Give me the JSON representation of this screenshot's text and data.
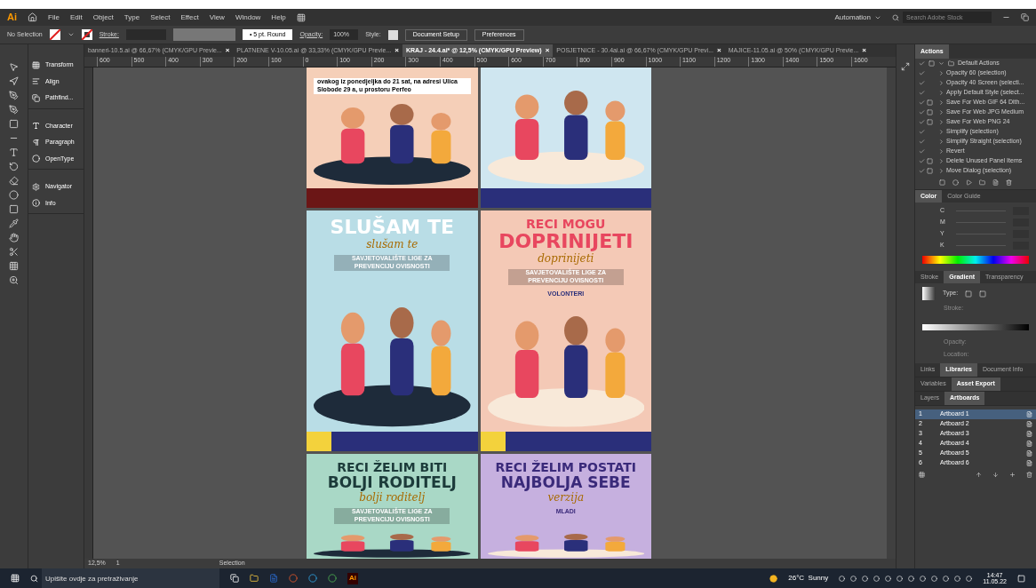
{
  "menu_bar": {
    "app_logo": "Ai",
    "items": [
      "File",
      "Edit",
      "Object",
      "Type",
      "Select",
      "Effect",
      "View",
      "Window",
      "Help"
    ],
    "workspace": "Automation",
    "search": {
      "placeholder": "Search Adobe Stock"
    }
  },
  "control_bar": {
    "selection": "No Selection",
    "stroke_label": "Stroke:",
    "brush": "• 5 pt. Round",
    "opacity_label": "Opacity:",
    "opacity": "100%",
    "style_label": "Style:",
    "buttons": [
      "Document Setup",
      "Preferences"
    ]
  },
  "document_tabs": [
    {
      "label": "banneri-10.5.ai @ 66,67% (CMYK/GPU Previe...",
      "close": "×",
      "selected": false
    },
    {
      "label": "PLATNENE V-10.05.ai @ 33,33% (CMYK/GPU Previe...",
      "close": "×",
      "selected": false
    },
    {
      "label": "KRAJ - 24.4.ai* @ 12,5% (CMYK/GPU Preview)",
      "close": "×",
      "selected": true
    },
    {
      "label": "POSJETNICE - 30.4ai.ai @ 66,67% (CMYK/GPU Previ...",
      "close": "×",
      "selected": false
    },
    {
      "label": "MAJICE-11.05.ai @ 50% (CMYK/GPU Previe...",
      "close": "×",
      "selected": false
    }
  ],
  "ruler_labels": [
    "600",
    "500",
    "400",
    "300",
    "200",
    "100",
    "0",
    "100",
    "200",
    "300",
    "400",
    "500",
    "600",
    "700",
    "800",
    "900",
    "1000",
    "1100",
    "1200",
    "1300",
    "1400",
    "1500",
    "1600"
  ],
  "left_panels": [
    [
      "Transform",
      "Align",
      "Pathfind..."
    ],
    [
      "Character",
      "Paragraph",
      "OpenType"
    ],
    [
      "Navigator",
      "Info"
    ]
  ],
  "posters": [
    {
      "note": "ovakog  iz ponedjeljka do 21 sat, na adresi Ulica Slobode 29 a, u prostoru Perfeo",
      "footer": true
    },
    {
      "footer": true
    },
    {
      "footer": true,
      "headline": [
        "SLUŠAM TE"
      ],
      "script": "slušam te",
      "subtitle": "SAVJETOVALIŠTE LIGE ZA PREVENCIJU OVISNOSTI"
    },
    {
      "footer": true,
      "headline": [
        "RECI MOGU",
        "DOPRINIJETI"
      ],
      "script": "doprinijeti",
      "subtitle": "SAVJETOVALIŠTE LIGE ZA PREVENCIJU OVISNOSTI",
      "note": "VOLONTERI"
    },
    {
      "headline": [
        "RECI ŽELIM BITI",
        "BOLJI RODITELJ"
      ],
      "script": "bolji roditelj",
      "subtitle": "SAVJETOVALIŠTE LIGE ZA PREVENCIJU OVISNOSTI"
    },
    {
      "headline": [
        "RECI ŽELIM POSTATI",
        "NAJBOLJA SEBE"
      ],
      "script": "verzija",
      "note": "MLADI"
    }
  ],
  "status_bar": {
    "zoom": "12,5%",
    "artboard": "1",
    "tool": "Selection"
  },
  "actions_panel": {
    "tab": "Actions",
    "set": {
      "label": "Default Actions",
      "expanded": true,
      "children": [
        {
          "label": "Opacity 60 (selection)",
          "dialog": false
        },
        {
          "label": "Opacity 40 Screen (selecti...",
          "dialog": false
        },
        {
          "label": "Apply Default Style (select...",
          "dialog": false
        },
        {
          "label": "Save For Web GIF 64 Dith...",
          "dialog": true
        },
        {
          "label": "Save For Web JPG Medium",
          "dialog": true
        },
        {
          "label": "Save For Web PNG 24",
          "dialog": true
        },
        {
          "label": "Simplify (selection)",
          "dialog": false
        },
        {
          "label": "Simplify Straight (selection)",
          "dialog": false
        },
        {
          "label": "Revert",
          "dialog": false
        },
        {
          "label": "Delete Unused Panel Items",
          "dialog": true
        },
        {
          "label": "Move Dialog (selection)",
          "dialog": true
        }
      ]
    }
  },
  "color_panel": {
    "tabs": [
      {
        "label": "Color",
        "selected": true
      },
      {
        "label": "Color Guide",
        "selected": false
      }
    ],
    "channels": [
      "C",
      "M",
      "Y",
      "K"
    ]
  },
  "gradient_panel": {
    "tabs": [
      {
        "label": "Stroke",
        "selected": false
      },
      {
        "label": "Gradient",
        "selected": true
      },
      {
        "label": "Transparency",
        "selected": false
      }
    ],
    "type_label": "Type:",
    "stroke_label": "Stroke:",
    "opacity_label": "Opacity:",
    "location_label": "Location:"
  },
  "tab_rows": [
    [
      {
        "label": "Links",
        "selected": false
      },
      {
        "label": "Libraries",
        "selected": true
      },
      {
        "label": "Document Info",
        "selected": false
      }
    ],
    [
      {
        "label": "Variables",
        "selected": false
      },
      {
        "label": "Asset Export",
        "selected": true
      }
    ],
    [
      {
        "label": "Layers",
        "selected": false
      },
      {
        "label": "Artboards",
        "selected": true
      }
    ]
  ],
  "artboards": [
    {
      "number": "1",
      "name": "Artboard 1",
      "selected": true
    },
    {
      "number": "2",
      "name": "Artboard 2",
      "selected": false
    },
    {
      "number": "3",
      "name": "Artboard 3",
      "selected": false
    },
    {
      "number": "4",
      "name": "Artboard 4",
      "selected": false
    },
    {
      "number": "5",
      "name": "Artboard 5",
      "selected": false
    },
    {
      "number": "6",
      "name": "Artboard 6",
      "selected": false
    }
  ],
  "taskbar": {
    "search": {
      "placeholder": "Upišite ovdje za pretraživanje"
    },
    "app_label": "Ai",
    "weather": "26°C  Sunny",
    "time": "14:47",
    "date": "11.05.22"
  }
}
